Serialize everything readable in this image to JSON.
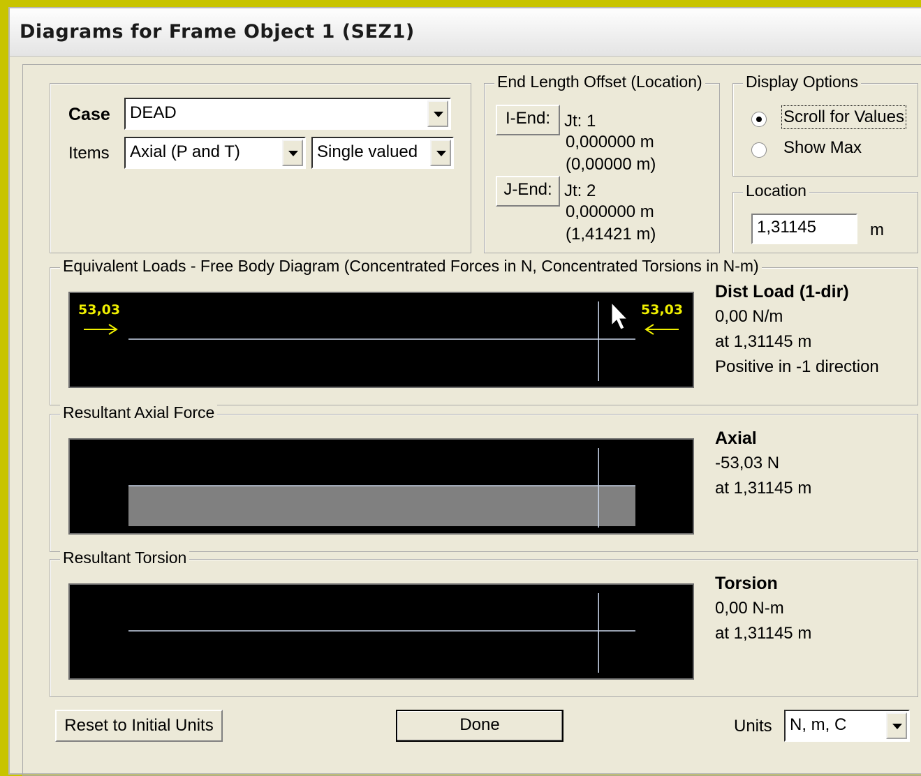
{
  "window": {
    "title": "Diagrams for Frame Object 1  (SEZ1)"
  },
  "case_group": {
    "case_label": "Case",
    "case_value": "DEAD",
    "items_label": "Items",
    "items_value": "Axial (P and T)",
    "valued_value": "Single valued"
  },
  "end_offset": {
    "title": "End Length Offset (Location)",
    "i_end_button": "I-End:",
    "i_jt": "Jt:  1",
    "i_offset": "0,000000 m",
    "i_location": "(0,00000 m)",
    "j_end_button": "J-End:",
    "j_jt": "Jt:  2",
    "j_offset": "0,000000 m",
    "j_location": "(1,41421 m)"
  },
  "display_options": {
    "title": "Display Options",
    "scroll_label": "Scroll for Values",
    "show_max_label": "Show Max",
    "selected": "scroll"
  },
  "location": {
    "title": "Location",
    "value": "1,31145",
    "unit": "m"
  },
  "equivalent_loads": {
    "title": "Equivalent Loads - Free Body Diagram  (Concentrated Forces in N, Concentrated Torsions in N-m)",
    "left_force": "53,03",
    "right_force": "53,03",
    "info_title": "Dist Load (1-dir)",
    "info_value": "0,00 N/m",
    "info_at": "at 1,31145 m",
    "info_note": "Positive in -1 direction"
  },
  "axial_force": {
    "title": "Resultant Axial Force",
    "info_title": "Axial",
    "info_value": "-53,03 N",
    "info_at": "at 1,31145 m"
  },
  "torsion": {
    "title": "Resultant Torsion",
    "info_title": "Torsion",
    "info_value": "0,00 N-m",
    "info_at": "at 1,31145 m"
  },
  "footer": {
    "reset_button": "Reset to Initial Units",
    "done_button": "Done",
    "units_label": "Units",
    "units_value": "N, m, C"
  },
  "chart_data": {
    "type": "area",
    "member_length": 1.41421,
    "cursor_location": 1.31145,
    "axial": {
      "x": [
        0,
        1.41421
      ],
      "values": [
        -53.03,
        -53.03
      ]
    },
    "torsion": {
      "x": [
        0,
        1.41421
      ],
      "values": [
        0,
        0
      ]
    },
    "colors": {
      "plot_bg": "#000000",
      "force_arrow": "#f0f000",
      "axis_line": "#c8d4e8",
      "fill": "#808080"
    }
  }
}
